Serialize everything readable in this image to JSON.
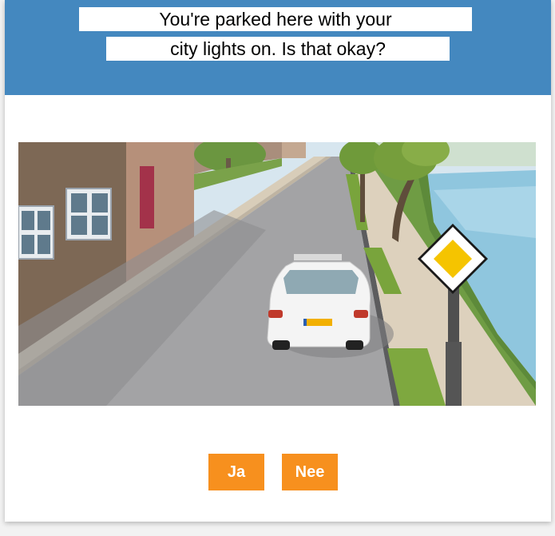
{
  "question": {
    "line1": "You're parked here with your",
    "line2": "city lights on. Is that okay?"
  },
  "answers": {
    "yes_label": "Ja",
    "no_label": "Nee"
  },
  "colors": {
    "header": "#4488bf",
    "button": "#f7901e",
    "button_text": "#ffffff"
  },
  "scene": {
    "icon": "priority-road-sign-icon"
  }
}
